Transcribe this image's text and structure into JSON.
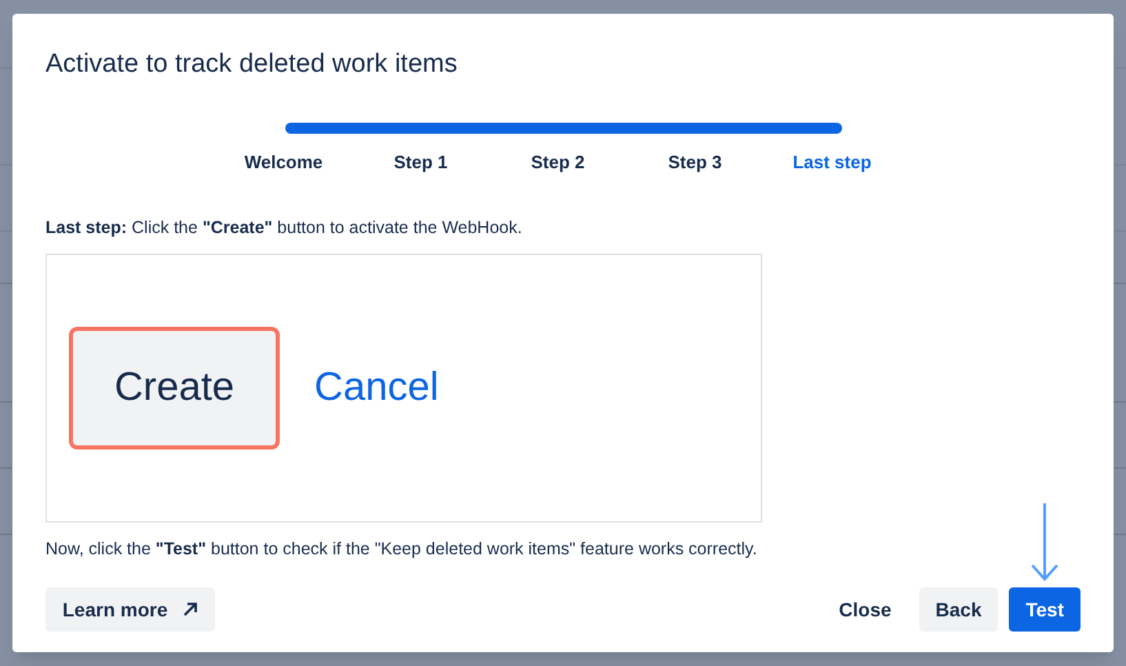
{
  "dialog": {
    "title": "Activate to track deleted work items",
    "progress": {
      "level": 1
    },
    "steps": [
      {
        "label": "Welcome",
        "selected": false
      },
      {
        "label": "Step 1",
        "selected": false
      },
      {
        "label": "Step 2",
        "selected": false
      },
      {
        "label": "Step 3",
        "selected": false
      },
      {
        "label": "Last step",
        "selected": true
      }
    ],
    "instruction": "**Last step:** Click the **\"Create\"** button to activate the WebHook.",
    "example": {
      "create_button": "Create",
      "cancel_link": "Cancel",
      "highlighted": true
    },
    "note": "Now, click the **\"Test\"** button to check if the \"Keep deleted work items\" feature works correctly.",
    "learn_more": "Learn more",
    "buttons": [
      {
        "label": "Close",
        "kind": "subtle"
      },
      {
        "label": "Back",
        "kind": "default"
      },
      {
        "label": "Test",
        "kind": "primary",
        "pointer": true
      }
    ]
  }
}
